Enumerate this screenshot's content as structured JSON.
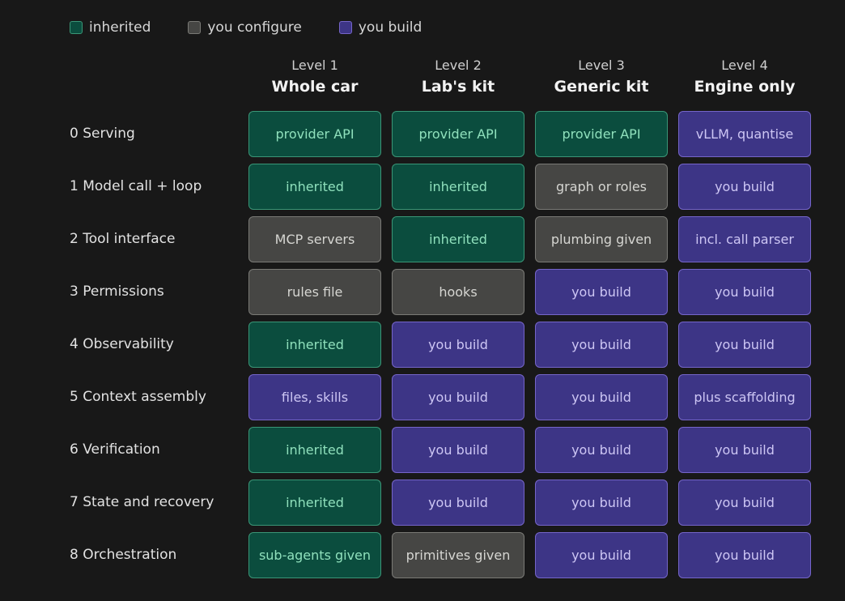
{
  "colors": {
    "inherited": {
      "fill": "#0b4d3e",
      "border": "#3a9677",
      "text": "#8fe0bc"
    },
    "configure": {
      "fill": "#464644",
      "border": "#7a7a76",
      "text": "#d6d6d2"
    },
    "build": {
      "fill": "#3d3586",
      "border": "#7565c9",
      "text": "#cdc6f4"
    }
  },
  "legend": [
    {
      "key": "inherited",
      "label": "inherited"
    },
    {
      "key": "configure",
      "label": "you configure"
    },
    {
      "key": "build",
      "label": "you build"
    }
  ],
  "columns": [
    {
      "level": "Level 1",
      "name": "Whole car"
    },
    {
      "level": "Level 2",
      "name": "Lab's kit"
    },
    {
      "level": "Level 3",
      "name": "Generic kit"
    },
    {
      "level": "Level 4",
      "name": "Engine only"
    }
  ],
  "rows": [
    {
      "label": "0 Serving",
      "cells": [
        {
          "text": "provider API",
          "kind": "inherited"
        },
        {
          "text": "provider API",
          "kind": "inherited"
        },
        {
          "text": "provider API",
          "kind": "inherited"
        },
        {
          "text": "vLLM, quantise",
          "kind": "build"
        }
      ]
    },
    {
      "label": "1 Model call + loop",
      "cells": [
        {
          "text": "inherited",
          "kind": "inherited"
        },
        {
          "text": "inherited",
          "kind": "inherited"
        },
        {
          "text": "graph or roles",
          "kind": "configure"
        },
        {
          "text": "you build",
          "kind": "build"
        }
      ]
    },
    {
      "label": "2 Tool interface",
      "cells": [
        {
          "text": "MCP servers",
          "kind": "configure"
        },
        {
          "text": "inherited",
          "kind": "inherited"
        },
        {
          "text": "plumbing given",
          "kind": "configure"
        },
        {
          "text": "incl. call parser",
          "kind": "build"
        }
      ]
    },
    {
      "label": "3 Permissions",
      "cells": [
        {
          "text": "rules file",
          "kind": "configure"
        },
        {
          "text": "hooks",
          "kind": "configure"
        },
        {
          "text": "you build",
          "kind": "build"
        },
        {
          "text": "you build",
          "kind": "build"
        }
      ]
    },
    {
      "label": "4 Observability",
      "cells": [
        {
          "text": "inherited",
          "kind": "inherited"
        },
        {
          "text": "you build",
          "kind": "build"
        },
        {
          "text": "you build",
          "kind": "build"
        },
        {
          "text": "you build",
          "kind": "build"
        }
      ]
    },
    {
      "label": "5 Context assembly",
      "cells": [
        {
          "text": "files, skills",
          "kind": "build"
        },
        {
          "text": "you build",
          "kind": "build"
        },
        {
          "text": "you build",
          "kind": "build"
        },
        {
          "text": "plus scaffolding",
          "kind": "build"
        }
      ]
    },
    {
      "label": "6 Verification",
      "cells": [
        {
          "text": "inherited",
          "kind": "inherited"
        },
        {
          "text": "you build",
          "kind": "build"
        },
        {
          "text": "you build",
          "kind": "build"
        },
        {
          "text": "you build",
          "kind": "build"
        }
      ]
    },
    {
      "label": "7 State and recovery",
      "cells": [
        {
          "text": "inherited",
          "kind": "inherited"
        },
        {
          "text": "you build",
          "kind": "build"
        },
        {
          "text": "you build",
          "kind": "build"
        },
        {
          "text": "you build",
          "kind": "build"
        }
      ]
    },
    {
      "label": "8 Orchestration",
      "cells": [
        {
          "text": "sub-agents given",
          "kind": "inherited"
        },
        {
          "text": "primitives given",
          "kind": "configure"
        },
        {
          "text": "you build",
          "kind": "build"
        },
        {
          "text": "you build",
          "kind": "build"
        }
      ]
    }
  ]
}
